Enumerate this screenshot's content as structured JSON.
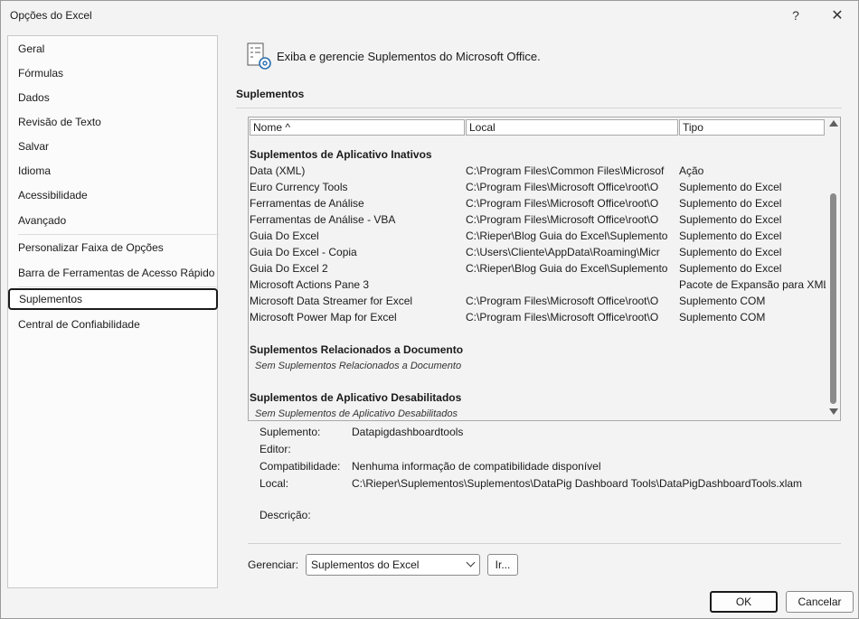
{
  "window": {
    "title": "Opções do Excel",
    "help": "?",
    "close": "✕"
  },
  "nav": {
    "items": [
      {
        "label": "Geral"
      },
      {
        "label": "Fórmulas"
      },
      {
        "label": "Dados"
      },
      {
        "label": "Revisão de Texto"
      },
      {
        "label": "Salvar"
      },
      {
        "label": "Idioma"
      },
      {
        "label": "Acessibilidade"
      },
      {
        "label": "Avançado"
      },
      {
        "label": "Personalizar Faixa de Opções"
      },
      {
        "label": "Barra de Ferramentas de Acesso Rápido"
      },
      {
        "label": "Suplementos"
      },
      {
        "label": "Central de Confiabilidade"
      }
    ],
    "active": "Suplementos"
  },
  "header": {
    "text": "Exiba e gerencie Suplementos do Microsoft Office.",
    "section_title": "Suplementos"
  },
  "addins": {
    "columns": {
      "name": "Nome ^",
      "local": "Local",
      "tipo": "Tipo"
    },
    "groups": {
      "inactive": "Suplementos de Aplicativo Inativos",
      "document": "Suplementos Relacionados a Documento",
      "document_empty": "Sem Suplementos Relacionados a Documento",
      "disabled": "Suplementos de Aplicativo Desabilitados",
      "disabled_empty": "Sem Suplementos de Aplicativo Desabilitados"
    },
    "rows": [
      {
        "name": "Data (XML)",
        "local": "C:\\Program Files\\Common Files\\Microsof",
        "tipo": "Ação"
      },
      {
        "name": "Euro Currency Tools",
        "local": "C:\\Program Files\\Microsoft Office\\root\\O",
        "tipo": "Suplemento do Excel"
      },
      {
        "name": "Ferramentas de Análise",
        "local": "C:\\Program Files\\Microsoft Office\\root\\O",
        "tipo": "Suplemento do Excel"
      },
      {
        "name": "Ferramentas de Análise - VBA",
        "local": "C:\\Program Files\\Microsoft Office\\root\\O",
        "tipo": "Suplemento do Excel"
      },
      {
        "name": "Guia Do Excel",
        "local": "C:\\Rieper\\Blog Guia do Excel\\Suplemento",
        "tipo": "Suplemento do Excel"
      },
      {
        "name": "Guia Do Excel - Copia",
        "local": "C:\\Users\\Cliente\\AppData\\Roaming\\Micr",
        "tipo": "Suplemento do Excel"
      },
      {
        "name": "Guia Do Excel 2",
        "local": "C:\\Rieper\\Blog Guia do Excel\\Suplemento",
        "tipo": "Suplemento do Excel"
      },
      {
        "name": "Microsoft Actions Pane 3",
        "local": "",
        "tipo": "Pacote de Expansão para XML"
      },
      {
        "name": "Microsoft Data Streamer for Excel",
        "local": "C:\\Program Files\\Microsoft Office\\root\\O",
        "tipo": "Suplemento COM"
      },
      {
        "name": "Microsoft Power Map for Excel",
        "local": "C:\\Program Files\\Microsoft Office\\root\\O",
        "tipo": "Suplemento COM"
      }
    ]
  },
  "details": {
    "suplemento_label": "Suplemento:",
    "suplemento_value": "Datapigdashboardtools",
    "editor_label": "Editor:",
    "editor_value": "",
    "compat_label": "Compatibilidade:",
    "compat_value": "Nenhuma informação de compatibilidade disponível",
    "local_label": "Local:",
    "local_value": "C:\\Rieper\\Suplementos\\Suplementos\\DataPig Dashboard Tools\\DataPigDashboardTools.xlam",
    "descricao_label": "Descrição:",
    "descricao_value": ""
  },
  "manage": {
    "label": "Gerenciar:",
    "selected": "Suplementos do Excel",
    "go": "Ir..."
  },
  "footer": {
    "ok": "OK",
    "cancel": "Cancelar"
  }
}
